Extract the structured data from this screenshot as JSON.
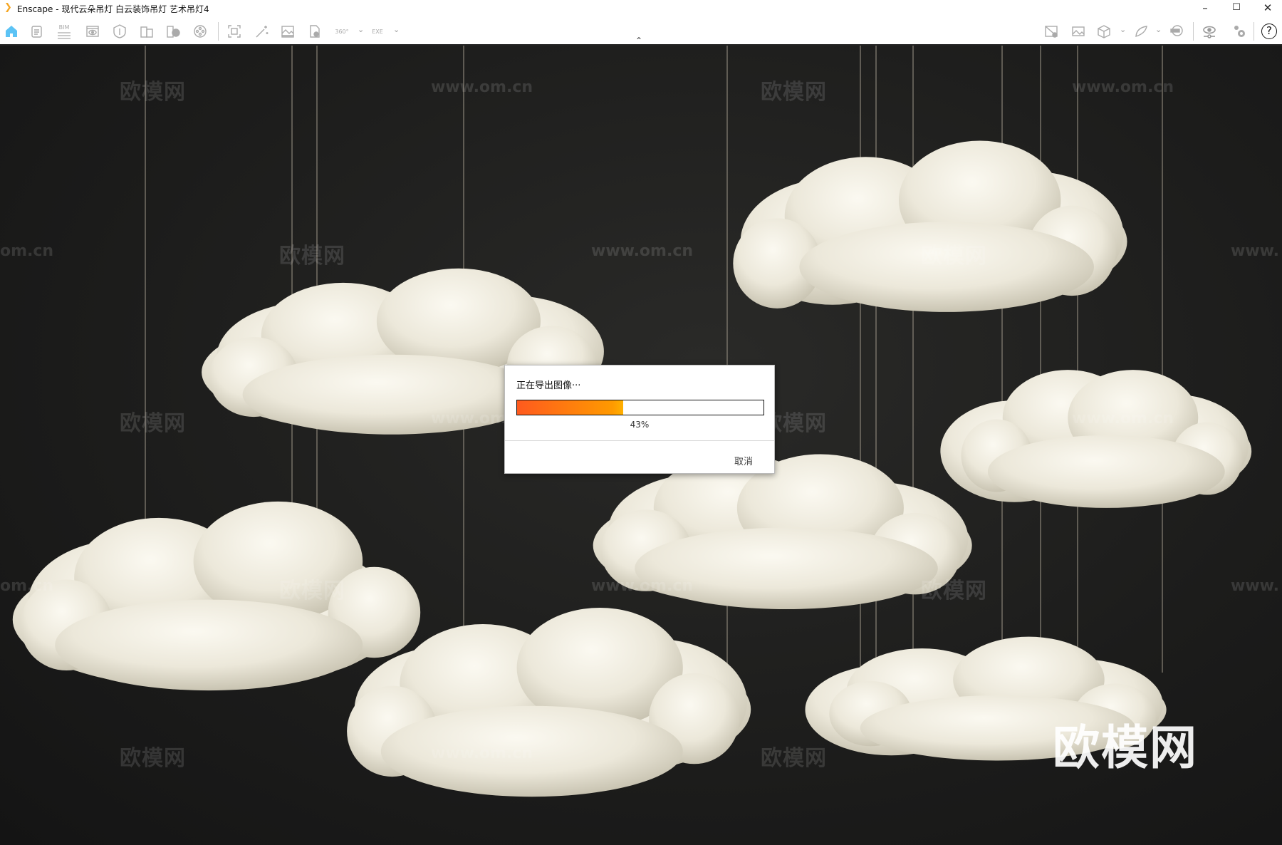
{
  "window": {
    "title": "Enscape - 现代云朵吊灯 白云装饰吊灯 艺术吊灯4",
    "minimize": "–",
    "maximize": "☐",
    "close": "✕"
  },
  "toolbar": {
    "left": [
      "home-icon",
      "notes-icon",
      "bim-icon",
      "view-eye-icon",
      "shield-icon",
      "building-icon",
      "building-lightning-icon",
      "film-reel-icon",
      "screenshot-icon",
      "magic-wand-icon",
      "image-icon",
      "export-file-icon",
      "panorama-360-icon",
      "exe-export-icon"
    ],
    "bim_label": "BIM",
    "pano_label": "360°",
    "exe_label": "EXE",
    "right": [
      "map-pin-icon",
      "image-strip-icon",
      "cube-icon",
      "wing-icon",
      "vr-headset-icon",
      "visual-settings-icon",
      "settings-gears-icon",
      "help-icon"
    ],
    "help": "?"
  },
  "watermarks": {
    "brand": "欧模网",
    "url": "www.om.cn",
    "url_partial": "om.cn",
    "url_start": "www."
  },
  "dialog": {
    "title": "正在导出图像···",
    "progress_percent": 43,
    "progress_label": "43%",
    "cancel": "取消",
    "bar_colors": [
      "#ff5a1e",
      "#ffb000"
    ]
  }
}
